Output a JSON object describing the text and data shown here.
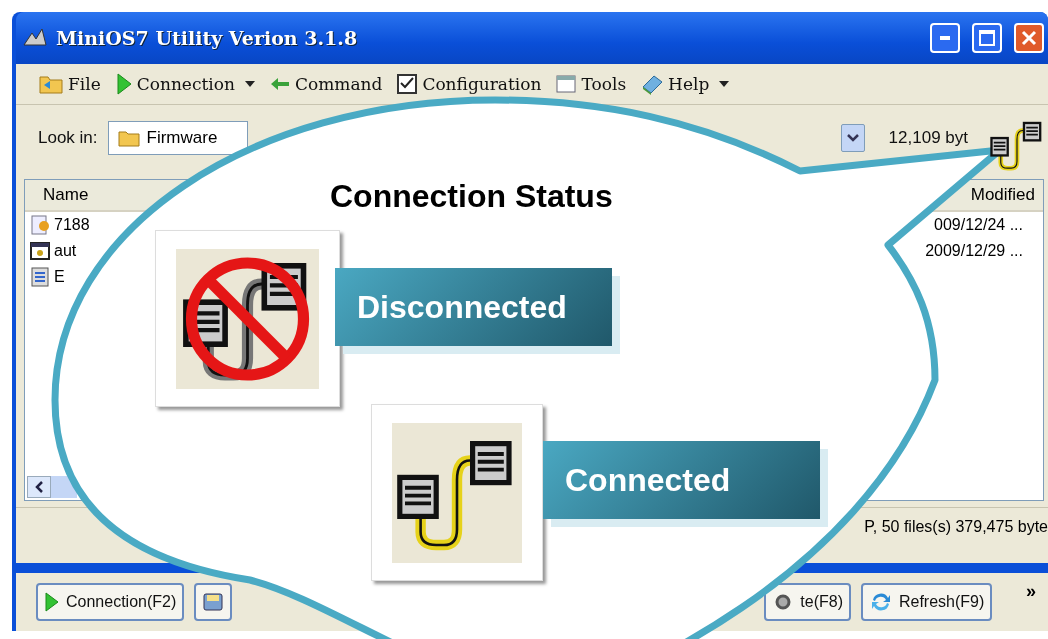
{
  "window": {
    "title": "MiniOS7 Utility Verion 3.1.8"
  },
  "toolbar": [
    {
      "label": "File",
      "dropdown": false
    },
    {
      "label": "Connection",
      "dropdown": true
    },
    {
      "label": "Command",
      "dropdown": false
    },
    {
      "label": "Configuration",
      "dropdown": false
    },
    {
      "label": "Tools",
      "dropdown": false
    },
    {
      "label": "Help",
      "dropdown": true
    }
  ],
  "look_in": {
    "label": "Look in:",
    "value": "Firmware",
    "size": "12,109 byt"
  },
  "file_list": {
    "columns": [
      "Name",
      "Modified"
    ],
    "rows": [
      {
        "name": "7188",
        "modified": "009/12/24 ..."
      },
      {
        "name": "aut",
        "modified": "2009/12/29 ..."
      },
      {
        "name": "E"
      }
    ]
  },
  "status_bar": "P, 50 files(s) 379,475 byte",
  "bottom_toolbar": [
    {
      "kind": "text",
      "label": "Connection(F2)"
    },
    {
      "kind": "icon"
    },
    {
      "kind": "text",
      "label": "te(F8)"
    },
    {
      "kind": "text",
      "label": "Refresh(F9)"
    }
  ],
  "overflow": "»",
  "callout": {
    "title": "Connection Status",
    "states": [
      {
        "label": "Disconnected",
        "connected": false
      },
      {
        "label": "Connected",
        "connected": true
      }
    ]
  }
}
